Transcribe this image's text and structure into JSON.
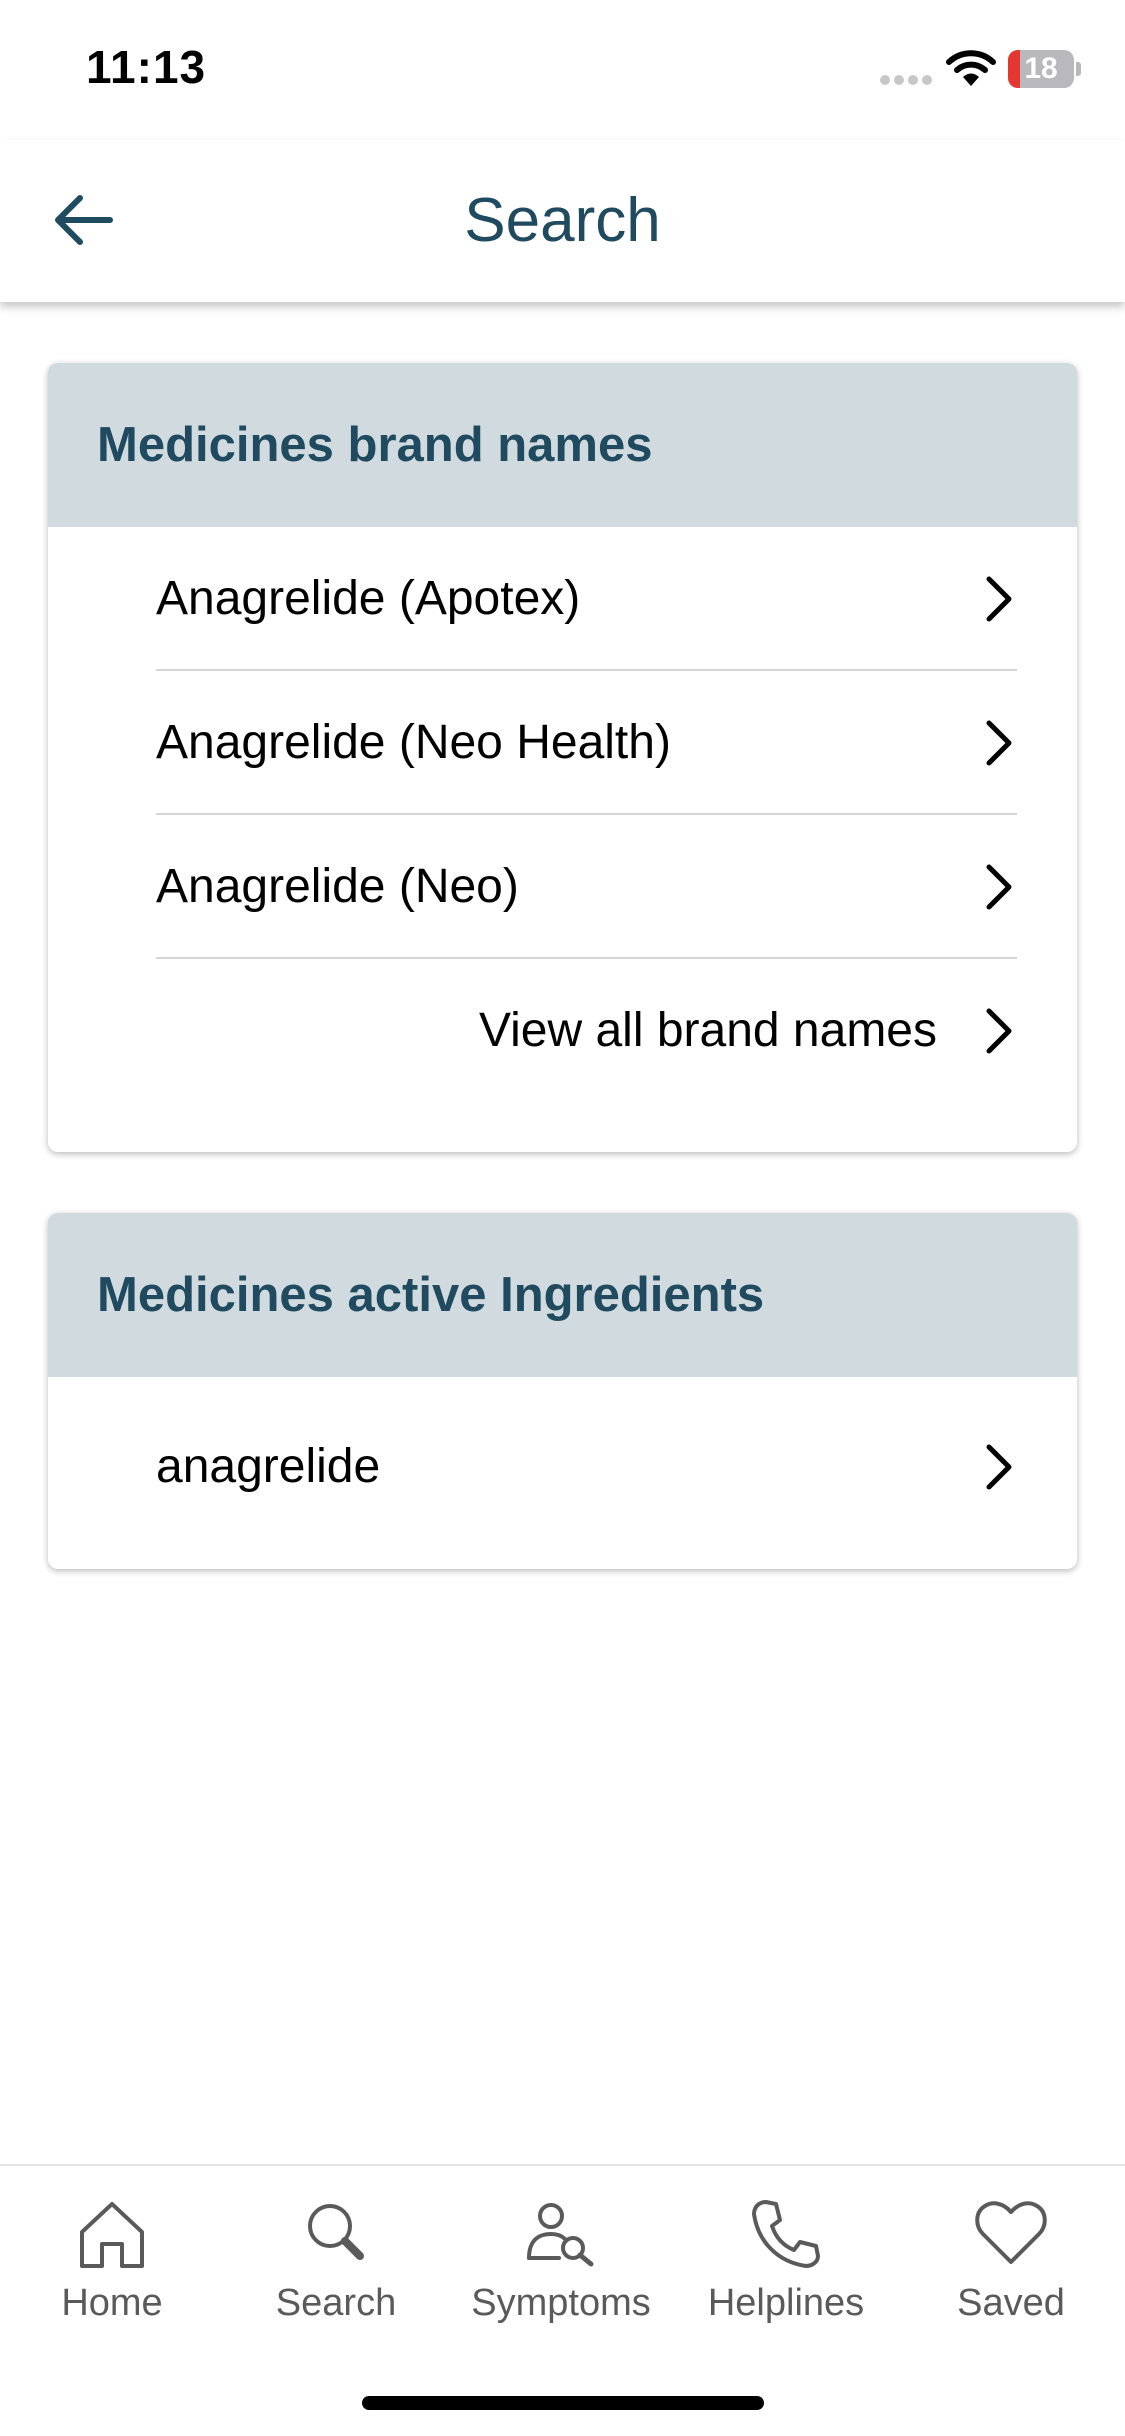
{
  "status_bar": {
    "time": "11:13",
    "battery_level": "18",
    "battery_fraction": 0.18,
    "battery_color": "#e5372f"
  },
  "header": {
    "title": "Search",
    "back_icon": "arrow-left-icon"
  },
  "brand_names_section": {
    "title": "Medicines brand names",
    "items": [
      {
        "label": "Anagrelide (Apotex)"
      },
      {
        "label": "Anagrelide (Neo Health)"
      },
      {
        "label": "Anagrelide (Neo)"
      }
    ],
    "view_all_label": "View all brand names"
  },
  "active_ingredients_section": {
    "title": "Medicines active Ingredients",
    "items": [
      {
        "label": "anagrelide"
      }
    ]
  },
  "tab_bar": {
    "tabs": [
      {
        "label": "Home",
        "icon": "home-icon"
      },
      {
        "label": "Search",
        "icon": "search-icon"
      },
      {
        "label": "Symptoms",
        "icon": "symptoms-icon"
      },
      {
        "label": "Helplines",
        "icon": "phone-icon"
      },
      {
        "label": "Saved",
        "icon": "heart-icon"
      }
    ]
  },
  "colors": {
    "accent": "#1f4a5f",
    "section_header_bg": "#d1dbdf",
    "tab_icon": "#5a5a5a"
  }
}
